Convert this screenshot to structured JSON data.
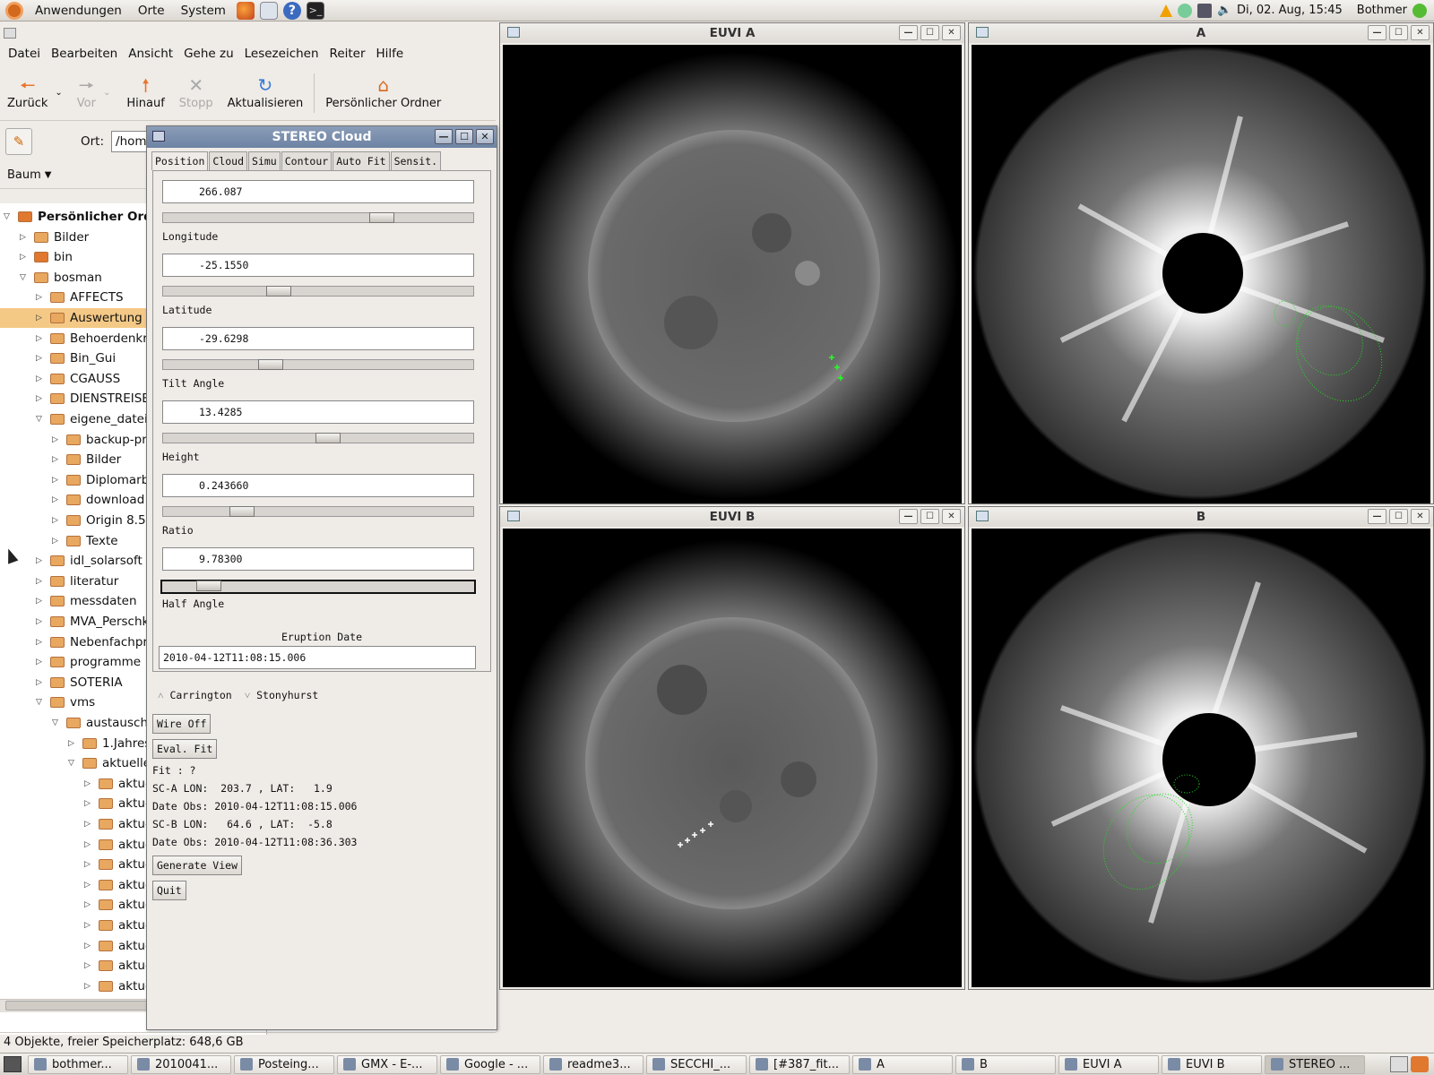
{
  "top_panel": {
    "menus": [
      "Anwendungen",
      "Orte",
      "System"
    ],
    "datetime": "Di, 02. Aug, 15:45",
    "user": "Bothmer"
  },
  "nautilus": {
    "menu": [
      "Datei",
      "Bearbeiten",
      "Ansicht",
      "Gehe zu",
      "Lesezeichen",
      "Reiter",
      "Hilfe"
    ],
    "toolbar": {
      "back": "Zurück",
      "forward": "Vor",
      "up": "Hinauf",
      "stop": "Stopp",
      "reload": "Aktualisieren",
      "home": "Persönlicher Ordner"
    },
    "location_label": "Ort:",
    "location_value": "/hom",
    "sidebar_mode": "Baum",
    "tree": [
      {
        "label": "Persönlicher Ord",
        "level": 0,
        "open": true,
        "home": true,
        "bold": true
      },
      {
        "label": "Bilder",
        "level": 1
      },
      {
        "label": "bin",
        "level": 1,
        "home": true
      },
      {
        "label": "bosman",
        "level": 1,
        "open": true
      },
      {
        "label": "AFFECTS",
        "level": 2
      },
      {
        "label": "Auswertung",
        "level": 2,
        "selected": true
      },
      {
        "label": "Behoerdenkra",
        "level": 2
      },
      {
        "label": "Bin_Gui",
        "level": 2
      },
      {
        "label": "CGAUSS",
        "level": 2
      },
      {
        "label": "DIENSTREISEN",
        "level": 2
      },
      {
        "label": "eigene_dateie",
        "level": 2,
        "open": true
      },
      {
        "label": "backup-pro",
        "level": 3
      },
      {
        "label": "Bilder",
        "level": 3
      },
      {
        "label": "Diplomarbe",
        "level": 3
      },
      {
        "label": "download",
        "level": 3
      },
      {
        "label": "Origin 8.5",
        "level": 3
      },
      {
        "label": "Texte",
        "level": 3
      },
      {
        "label": "idl_solarsoft",
        "level": 2
      },
      {
        "label": "literatur",
        "level": 2
      },
      {
        "label": "messdaten",
        "level": 2
      },
      {
        "label": "MVA_Perschke",
        "level": 2
      },
      {
        "label": "Nebenfachpra",
        "level": 2
      },
      {
        "label": "programme",
        "level": 2
      },
      {
        "label": "SOTERIA",
        "level": 2
      },
      {
        "label": "vms",
        "level": 2,
        "open": true
      },
      {
        "label": "austausch",
        "level": 3,
        "open": true
      },
      {
        "label": "1.Jahres",
        "level": 4
      },
      {
        "label": "aktuelle_",
        "level": 4,
        "open": true
      },
      {
        "label": "aktue",
        "level": 5
      },
      {
        "label": "aktue",
        "level": 5
      },
      {
        "label": "aktue",
        "level": 5
      },
      {
        "label": "aktue",
        "level": 5
      },
      {
        "label": "aktue",
        "level": 5
      },
      {
        "label": "aktue",
        "level": 5
      },
      {
        "label": "aktue",
        "level": 5
      },
      {
        "label": "aktuellste_ergebnisse_j",
        "level": 5
      },
      {
        "label": "aktuellste_ergebnisse_r",
        "level": 5
      },
      {
        "label": "aktuellste_ergebnisse_r",
        "level": 5
      },
      {
        "label": "aktuellste_ergebnisse_r",
        "level": 5
      },
      {
        "label": "aktuellste_ergebnisse_c",
        "level": 5
      }
    ],
    "status": "4 Objekte, freier Speicherplatz: 648,6 GB"
  },
  "stereo": {
    "title": "STEREO Cloud",
    "tabs": [
      "Position",
      "Cloud",
      "Simu",
      "Contour",
      "Auto Fit",
      "Sensit."
    ],
    "params": [
      {
        "label": "Longitude",
        "value": "266.087",
        "level": 0.72
      },
      {
        "label": "Latitude",
        "value": "-25.1550",
        "level": 0.36
      },
      {
        "label": "Tilt Angle",
        "value": "-29.6298",
        "level": 0.33
      },
      {
        "label": "Height",
        "value": "13.4285",
        "level": 0.53
      },
      {
        "label": "Ratio",
        "value": "0.243660",
        "level": 0.23
      },
      {
        "label": "Half Angle",
        "value": "9.78300",
        "level": 0.12
      }
    ],
    "eruption_label": "Eruption Date",
    "eruption_value": "2010-04-12T11:08:15.006",
    "radio_carrington": "Carrington",
    "radio_stonyhurst": "Stonyhurst",
    "btn_wire": "Wire Off",
    "btn_eval": "Eval. Fit",
    "fit": "Fit : ?",
    "sca": "SC-A LON:  203.7 , LAT:   1.9",
    "date_a": "Date Obs: 2010-04-12T11:08:15.006",
    "scb": "SC-B LON:   64.6 , LAT:  -5.8",
    "date_b": "Date Obs: 2010-04-12T11:08:36.303",
    "btn_generate": "Generate View",
    "btn_quit": "Quit"
  },
  "windows": {
    "euvi_a": "EUVI A",
    "a": "A",
    "euvi_b": "EUVI B",
    "b": "B"
  },
  "taskbar": [
    {
      "label": "bothmer...",
      "active": false
    },
    {
      "label": "2010041...",
      "active": false
    },
    {
      "label": "Posteing...",
      "active": false
    },
    {
      "label": "GMX - E-...",
      "active": false
    },
    {
      "label": "Google - ...",
      "active": false
    },
    {
      "label": "readme3...",
      "active": false
    },
    {
      "label": "SECCHI_...",
      "active": false
    },
    {
      "label": "[#387_fit...",
      "active": false
    },
    {
      "label": "A",
      "active": false
    },
    {
      "label": "B",
      "active": false
    },
    {
      "label": "EUVI A",
      "active": false
    },
    {
      "label": "EUVI B",
      "active": false
    },
    {
      "label": "STEREO ...",
      "active": true
    }
  ]
}
